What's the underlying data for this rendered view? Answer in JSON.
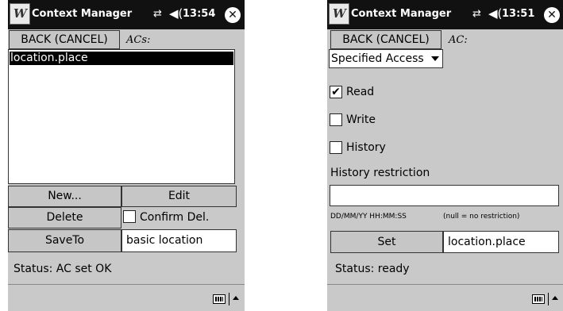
{
  "left_screen": {
    "titlebar": {
      "title": "Context Manager",
      "clock": "13:54"
    },
    "back_button": "BACK (CANCEL)",
    "acs_label": "ACs:",
    "list_items": [
      "location.place"
    ],
    "new_button": "New...",
    "edit_button": "Edit",
    "delete_button": "Delete",
    "confirm_delete_label": "Confirm Del.",
    "saveto_button": "SaveTo",
    "saveto_value": "basic location",
    "status": "Status: AC set OK"
  },
  "right_screen": {
    "titlebar": {
      "title": "Context Manager",
      "clock": "13:51"
    },
    "back_button": "BACK (CANCEL)",
    "ac_label": "AC:",
    "access_dropdown": "Specified Access",
    "read_label": "Read",
    "read_checked": true,
    "write_label": "Write",
    "write_checked": false,
    "history_label": "History",
    "history_checked": false,
    "history_restriction_label": "History restriction",
    "history_restriction_value": "",
    "date_format_hint": "DD/MM/YY HH:MM:SS",
    "null_hint": "(null = no restriction)",
    "set_button": "Set",
    "set_value": "location.place",
    "status": "Status: ready"
  },
  "icons": {
    "start": "windows-flag-icon",
    "connectivity": "connectivity-icon",
    "volume": "volume-icon",
    "close": "close-icon",
    "keyboard": "keyboard-icon",
    "sip_arrow": "sip-up-arrow-icon"
  },
  "glyphs": {
    "connectivity": "⇄",
    "volume": "◀(",
    "close": "✕",
    "check": "✔"
  }
}
